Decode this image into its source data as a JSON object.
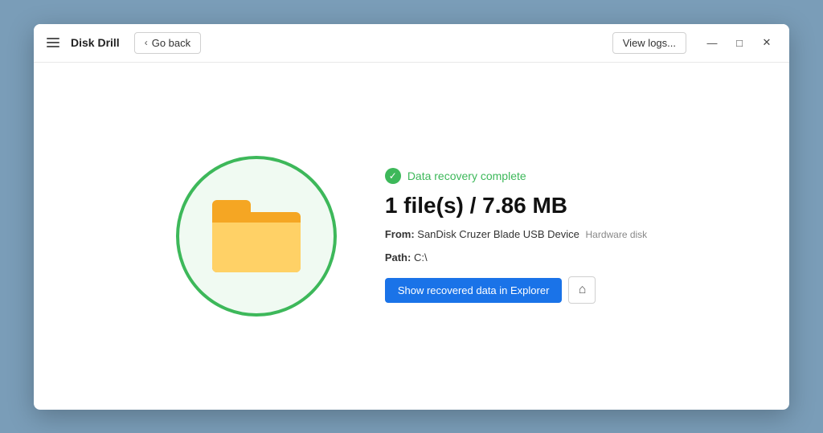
{
  "app": {
    "title": "Disk Drill",
    "go_back_label": "Go back",
    "view_logs_label": "View logs..."
  },
  "window_controls": {
    "minimize": "—",
    "maximize": "□",
    "close": "✕"
  },
  "content": {
    "status_label": "Data recovery complete",
    "file_count": "1 file(s) / 7.86 MB",
    "from_label": "From:",
    "from_device": "SanDisk Cruzer Blade USB Device",
    "from_type": "Hardware disk",
    "path_label": "Path:",
    "path_value": "C:\\",
    "show_explorer_label": "Show recovered data in Explorer"
  }
}
